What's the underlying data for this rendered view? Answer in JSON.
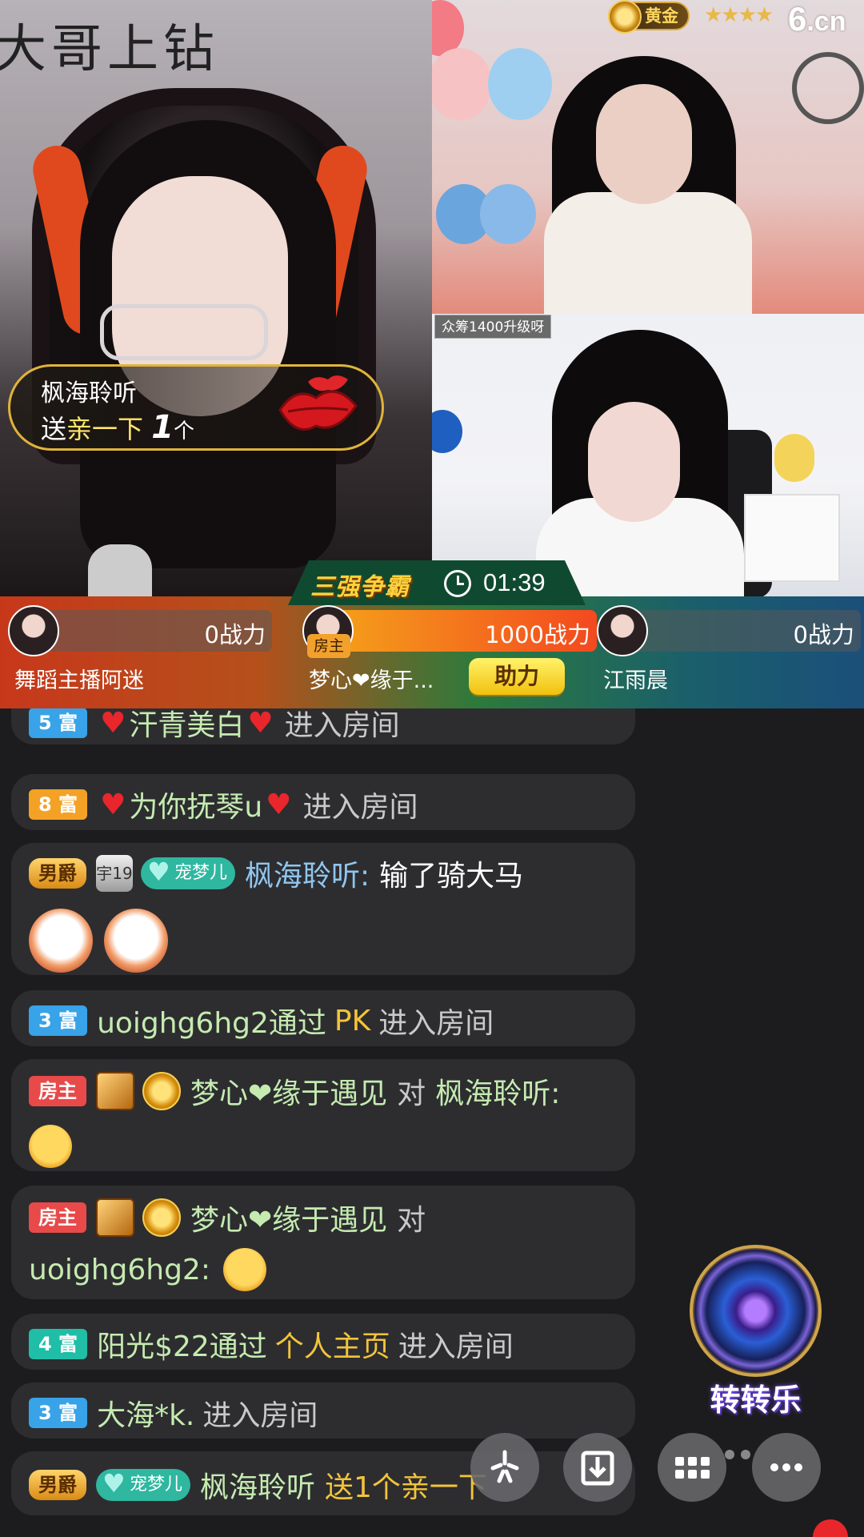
{
  "video": {
    "main_overlay_text": "大哥上钻",
    "anchor_rank_badge": "黄金",
    "rank_stars": "★★★★",
    "site_logo": {
      "digit": "6",
      "suffix": ".cn"
    },
    "crowdfund_tag": "众筹1400升级呀"
  },
  "gift_banner": {
    "sender": "枫海聆听",
    "verb": "送",
    "gift_name": "亲一下",
    "count": "1",
    "unit": "个"
  },
  "pk": {
    "title": "三强争霸",
    "timer": "01:39",
    "slots": [
      {
        "name": "舞蹈主播阿迷",
        "power": "0战力",
        "leading": false
      },
      {
        "name": "梦心❤缘于...",
        "power": "1000战力",
        "leading": true,
        "role_tag": "房主"
      },
      {
        "name": "江雨晨",
        "power": "0战力",
        "leading": false
      }
    ],
    "help_button": "助力"
  },
  "chat": {
    "messages": [
      {
        "level": "5 富",
        "text_parts": [
          "汗青美白",
          "进入房间"
        ]
      },
      {
        "level": "8 富",
        "user": "为你抚琴u",
        "action": "进入房间"
      },
      {
        "badge": "男爵",
        "shield": "宇19",
        "pet": "宠梦儿",
        "user": "枫海聆听:",
        "content": "输了骑大马"
      },
      {
        "level": "3 富",
        "user": "uoighg6hg2通过",
        "via": "PK",
        "action": "进入房间"
      },
      {
        "role": "房主",
        "user": "梦心❤缘于遇见",
        "to": "对",
        "target": "枫海聆听:"
      },
      {
        "role": "房主",
        "user": "梦心❤缘于遇见",
        "to": "对",
        "target": "uoighg6hg2:"
      },
      {
        "level": "4 富",
        "user": "阳光$22通过",
        "via": "个人主页",
        "action": "进入房间"
      },
      {
        "level": "3 富",
        "user": "大海*k.",
        "action": "进入房间"
      },
      {
        "badge": "男爵",
        "pet": "宠梦儿",
        "user": "枫海聆听",
        "action": "送1个亲一下"
      }
    ]
  },
  "widgets": {
    "lucky_wheel_label": "转转乐",
    "icons": [
      "share-icon",
      "download-icon",
      "grid-menu-icon",
      "more-icon"
    ]
  },
  "colors": {
    "chat_bg": "#1c1c1e",
    "bubble": "#2d2d30",
    "accent_yellow": "#f3c43a",
    "heart": "#e8262c"
  }
}
